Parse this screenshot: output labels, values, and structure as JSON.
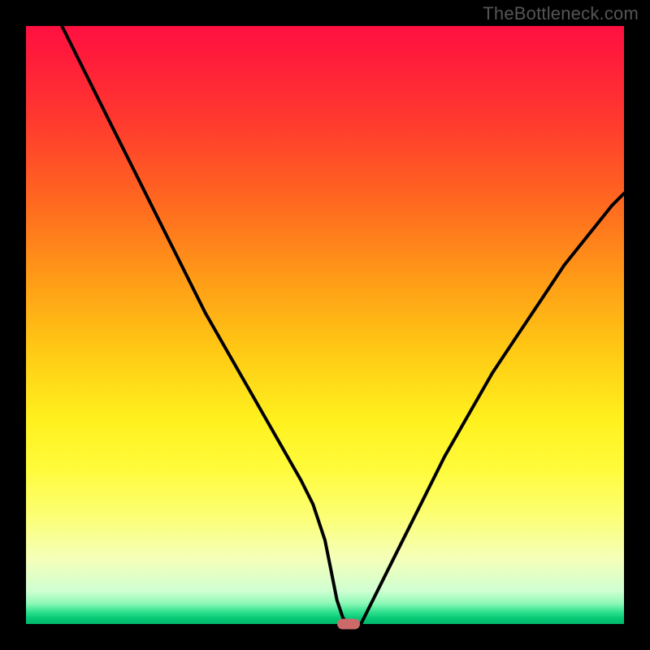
{
  "watermark": "TheBottleneck.com",
  "chart_data": {
    "type": "line",
    "title": "",
    "xlabel": "",
    "ylabel": "",
    "xlim": [
      0,
      100
    ],
    "ylim": [
      0,
      100
    ],
    "x": [
      6,
      10,
      14,
      18,
      22,
      26,
      30,
      34,
      38,
      42,
      46,
      48,
      50,
      51,
      52,
      53,
      54,
      56,
      58,
      62,
      66,
      70,
      74,
      78,
      82,
      86,
      90,
      94,
      98,
      100
    ],
    "y": [
      100,
      92,
      84,
      76,
      68,
      60,
      52,
      45,
      38,
      31,
      24,
      20,
      14,
      9,
      4,
      1,
      0,
      0,
      4,
      12,
      20,
      28,
      35,
      42,
      48,
      54,
      60,
      65,
      70,
      72
    ],
    "marker": {
      "x": 54,
      "y": 0
    },
    "gradient_top": "#ff1040",
    "gradient_bottom": "#00b86a"
  }
}
